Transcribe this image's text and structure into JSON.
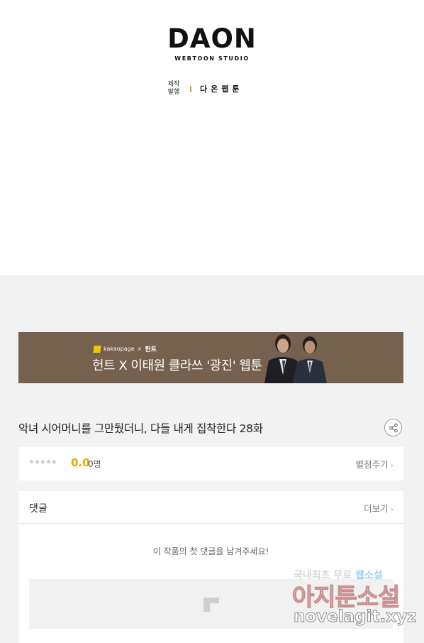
{
  "header": {
    "logo_main": "DAON",
    "logo_sub": "WEBTOON STUDIO",
    "credit_label": "제작 발행",
    "credit_value": "다온웹툰"
  },
  "banner": {
    "brand_kakao": "kakaopage",
    "brand_x": "×",
    "brand_hunt": "헌트",
    "title": "헌트 X 이태원 클라쓰 '광진' 웹툰"
  },
  "episode": {
    "title": "악녀 시어머니를 그만뒀더니, 다들 내게 집착한다 28화"
  },
  "rating": {
    "stars": "★★★★★",
    "score": "0.0",
    "count": "0명",
    "rate_link": "별점주기"
  },
  "comments": {
    "title": "댓글",
    "more_link": "더보기",
    "empty_message": "이 작품의 첫 댓글을 남겨주세요!"
  },
  "watermark": {
    "line1_a": "국내최초 무료",
    "line1_b": "웹소설",
    "line2": "아지툰소설",
    "line3": "novelagit.xyz"
  },
  "colors": {
    "accent_score": "#f0a500",
    "banner_bg": "#76604e",
    "credit_bar": "#c9a14a"
  }
}
